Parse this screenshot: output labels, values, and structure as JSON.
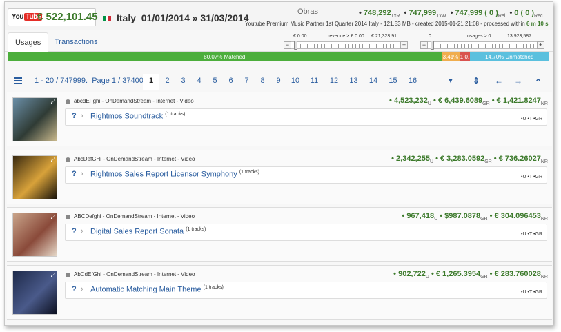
{
  "header": {
    "yt_logo": {
      "you": "You",
      "tube": "Tube"
    },
    "total_amount": "€ 522,101.45",
    "flag_colors": [
      "#009246",
      "#ffffff",
      "#ce2b37"
    ],
    "country": "Italy",
    "period": "01/01/2014  »  31/03/2014",
    "obras_label": "Obras",
    "stats": {
      "txr": "748,292",
      "txr_sub": "TxR",
      "txw": "747,999",
      "txw_sub": "TxW",
      "rel": "747,999",
      "rel_paren": "( 0 )",
      "rel_sub": "Rel",
      "rec": "0",
      "rec_paren": "( 0 )",
      "rec_sub": "Rec"
    },
    "meta_line": "Youtube Premium Music Partner 1st Quarter 2014 Italy - 121.53 MB - created 2015-01-21 21:08 - processed within",
    "meta_duration": "6 m 10 s"
  },
  "tabs": [
    {
      "label": "Usages",
      "active": true
    },
    {
      "label": "Transactions",
      "active": false
    }
  ],
  "revenue_slider": {
    "min_label": "€ 0.00",
    "filter_label": "revenue > € 0.00",
    "max_label": "€ 21,323.91",
    "minus": "−",
    "plus": "+"
  },
  "usages_slider": {
    "min_label": "0",
    "filter_label": "usages > 0",
    "max_label": "13,923,587",
    "minus": "−",
    "plus": "+"
  },
  "progress": [
    {
      "label": "80.07% Matched",
      "percent": 80.07,
      "color": "#4cae3c"
    },
    {
      "label": "3.41%",
      "percent": 3.41,
      "color": "#f0ad4e"
    },
    {
      "label": "1.0.",
      "percent": 1.82,
      "color": "#d9534f"
    },
    {
      "label": "14.70% Unmatched",
      "percent": 14.7,
      "color": "#5bc0de"
    }
  ],
  "pagination": {
    "range_text": "1 - 20 / 747999.",
    "page_text": "Page 1 / 37400",
    "pages": [
      "1",
      "2",
      "3",
      "4",
      "5",
      "6",
      "7",
      "8",
      "9",
      "10",
      "11",
      "12",
      "13",
      "14",
      "15",
      "16"
    ],
    "current": "1",
    "icons": {
      "filter": "▼",
      "sort": "⇕",
      "prev": "←",
      "next": "→",
      "up": "⌃"
    }
  },
  "rows": [
    {
      "source": "abcdEFghi  -  OnDemandStream  -  Internet  -  Video",
      "usages": "4,523,232",
      "gross": "€ 6,439.6089",
      "net": "€ 1,421.8247",
      "title": "Rightmos Soundtrack",
      "tracks": "(1  tracks)",
      "thumb_colors": [
        "#6b8fa8",
        "#2f3b35",
        "#c8b88c"
      ]
    },
    {
      "source": "AbcDefGHi  -  OnDemandStream  -  Internet  -  Video",
      "usages": "2,342,255",
      "gross": "€ 3,283.0592",
      "net": "€ 736.26027",
      "title": "Rightmos Sales Report Licensor Symphony",
      "tracks": "(1  tracks)",
      "thumb_colors": [
        "#3a2a10",
        "#d8a23a",
        "#1a140a"
      ]
    },
    {
      "source": "ABCDefghi  -  OnDemandStream  -  Internet  -  Video",
      "usages": "967,418",
      "gross": "$987.0878",
      "net": "€ 304.096453",
      "title": "Digital Sales Report Sonata",
      "tracks": "(1  tracks)",
      "thumb_colors": [
        "#c9a48a",
        "#8a4a3a",
        "#e6d8c8"
      ]
    },
    {
      "source": "AbCdEfGhi  -  OnDemandStream  -  Internet  -  Video",
      "usages": "902,722",
      "gross": "€ 1,265.3954",
      "net": "€ 283.760028",
      "title": "Automatic Matching Main Theme",
      "tracks": "(1  tracks)",
      "thumb_colors": [
        "#1e2a4a",
        "#4a5a8a",
        "#0c1020"
      ]
    }
  ],
  "subs": {
    "u": "U",
    "gr": "GR",
    "nr": "NR"
  },
  "row_flags": [
    "U",
    "T",
    "GR"
  ]
}
